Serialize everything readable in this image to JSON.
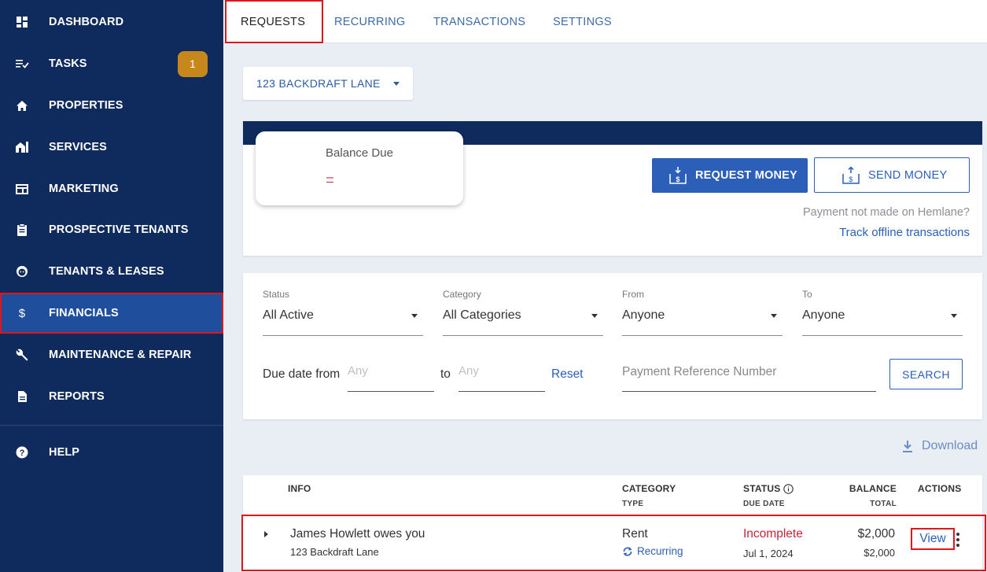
{
  "sidebar": {
    "items": [
      {
        "label": "DASHBOARD",
        "icon": "dashboard-icon"
      },
      {
        "label": "TASKS",
        "icon": "tasks-icon",
        "badge": "1"
      },
      {
        "label": "PROPERTIES",
        "icon": "home-icon"
      },
      {
        "label": "SERVICES",
        "icon": "services-icon"
      },
      {
        "label": "MARKETING",
        "icon": "marketing-icon"
      },
      {
        "label": "PROSPECTIVE TENANTS",
        "icon": "clipboard-icon"
      },
      {
        "label": "TENANTS & LEASES",
        "icon": "face-icon"
      },
      {
        "label": "FINANCIALS",
        "icon": "dollar-icon"
      },
      {
        "label": "MAINTENANCE & REPAIR",
        "icon": "wrench-icon"
      },
      {
        "label": "REPORTS",
        "icon": "document-icon"
      },
      {
        "label": "HELP",
        "icon": "help-icon"
      }
    ]
  },
  "tabs": [
    {
      "label": "REQUESTS",
      "active": true
    },
    {
      "label": "RECURRING"
    },
    {
      "label": "TRANSACTIONS"
    },
    {
      "label": "SETTINGS"
    }
  ],
  "property_select": {
    "value": "123 BACKDRAFT LANE"
  },
  "balance": {
    "title": "Balance Due",
    "value": "–"
  },
  "actions": {
    "request_money": "REQUEST MONEY",
    "send_money": "SEND MONEY",
    "offline_note": "Payment not made on Hemlane?",
    "offline_link": "Track offline transactions"
  },
  "filters": {
    "status": {
      "label": "Status",
      "value": "All Active"
    },
    "category": {
      "label": "Category",
      "value": "All Categories"
    },
    "from": {
      "label": "From",
      "value": "Anyone"
    },
    "to": {
      "label": "To",
      "value": "Anyone"
    },
    "due_from_label": "Due date from",
    "due_from_placeholder": "Any",
    "to_label": "to",
    "due_to_placeholder": "Any",
    "reset": "Reset",
    "reference_placeholder": "Payment Reference Number",
    "search": "SEARCH"
  },
  "download": "Download",
  "table": {
    "headers": {
      "info": "INFO",
      "category": "CATEGORY",
      "category_sub": "TYPE",
      "status": "STATUS",
      "status_sub": "DUE DATE",
      "balance": "BALANCE",
      "balance_sub": "TOTAL",
      "actions": "ACTIONS"
    },
    "rows": [
      {
        "info": "James Howlett owes you",
        "address": "123 Backdraft Lane",
        "category": "Rent",
        "type": "Recurring",
        "status": "Incomplete",
        "due_date": "Jul 1, 2024",
        "balance": "$2,000",
        "total": "$2,000",
        "action": "View"
      }
    ]
  },
  "colors": {
    "sidebar": "#0f2a5c",
    "active": "#1f4f9c",
    "accent": "#2b5fb8",
    "alert": "#c4233a",
    "badge": "#c8871a"
  }
}
